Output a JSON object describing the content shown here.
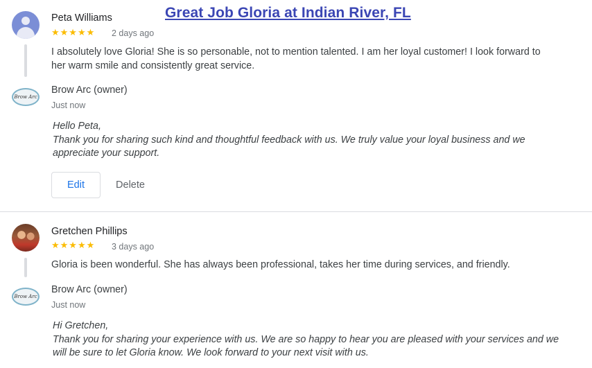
{
  "banner": {
    "text": "Great Job Gloria at Indian River, FL"
  },
  "reviews": [
    {
      "reviewer": "Peta Williams",
      "stars": "★★★★★",
      "rating": 5,
      "date": "2 days ago",
      "text": "I absolutely love Gloria! She is so personable, not to mention talented. I am her loyal customer! I look forward to her warm smile and consistently great service.",
      "reply": {
        "owner": "Brow Arc (owner)",
        "logo_text": "Brow Arc",
        "time": "Just now",
        "greeting": "Hello Peta,",
        "body": "Thank you for sharing such kind and thoughtful feedback with us. We truly value your loyal business and we appreciate your support."
      },
      "actions": {
        "edit": "Edit",
        "delete": "Delete"
      }
    },
    {
      "reviewer": "Gretchen Phillips",
      "stars": "★★★★★",
      "rating": 5,
      "date": "3 days ago",
      "text": "Gloria is been wonderful. She has always been professional, takes her time during services, and friendly.",
      "reply": {
        "owner": "Brow Arc (owner)",
        "logo_text": "Brow Arc",
        "time": "Just now",
        "greeting": "Hi Gretchen,",
        "body": "Thank you for sharing your experience with us. We are so happy to hear you are pleased with your services and we will be sure to let Gloria know. We look forward to your next visit with us."
      }
    }
  ],
  "colors": {
    "banner": "#3b46b4",
    "star": "#fbbc04",
    "link": "#1a73e8"
  }
}
